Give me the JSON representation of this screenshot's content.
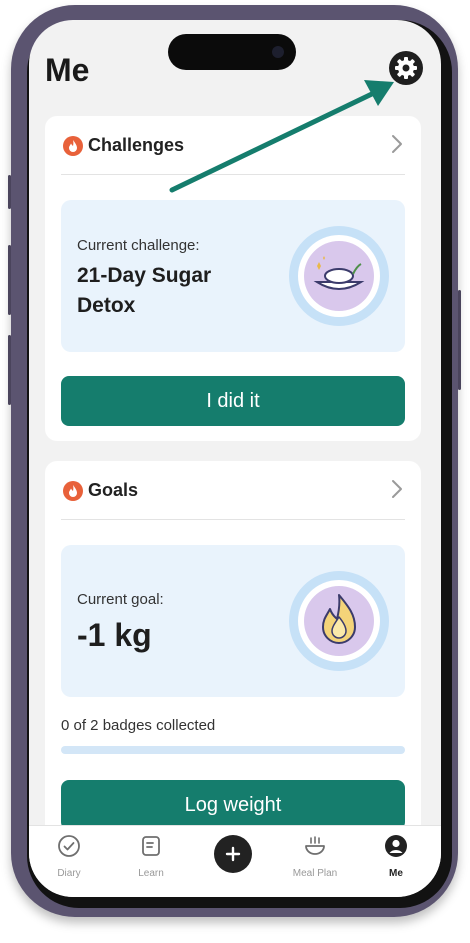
{
  "page": {
    "title": "Me"
  },
  "challenges": {
    "title": "Challenges",
    "current_label": "Current challenge:",
    "current_value_line1": "21-Day Sugar",
    "current_value_line2": "Detox",
    "button_label": "I did it"
  },
  "goals": {
    "title": "Goals",
    "current_label": "Current goal:",
    "current_value": "-1 kg",
    "badges_text": "0 of 2 badges collected",
    "badges_collected": 0,
    "badges_total": 2,
    "button_label": "Log weight"
  },
  "tabbar": {
    "items": [
      {
        "label": "Diary",
        "icon": "check-circle-icon"
      },
      {
        "label": "Learn",
        "icon": "document-icon"
      },
      {
        "label": "",
        "icon": "plus-icon"
      },
      {
        "label": "Meal Plan",
        "icon": "bowl-icon"
      },
      {
        "label": "Me",
        "icon": "user-icon",
        "active": true
      }
    ]
  },
  "colors": {
    "accent": "#157d6d",
    "flame": "#e8613a",
    "info_bg": "#e9f3fc",
    "medal_ring": "#c6e1f7",
    "medal_center": "#d9c8ec"
  }
}
